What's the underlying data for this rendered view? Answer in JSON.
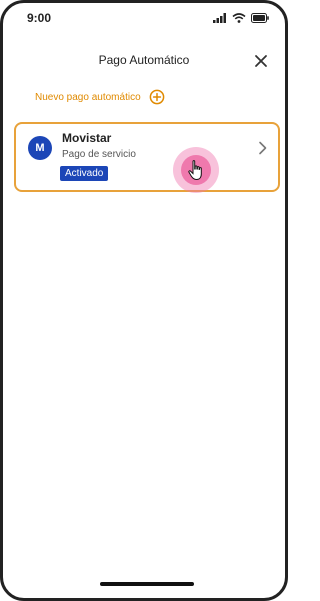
{
  "status_bar": {
    "time": "9:00",
    "icons": [
      "signal-icon",
      "wifi-icon",
      "battery-icon"
    ]
  },
  "header": {
    "title": "Pago Automático",
    "close_icon": "close-icon"
  },
  "new_auto_payment": {
    "label": "Nuevo pago automático",
    "icon": "plus-circle-icon"
  },
  "payments": [
    {
      "avatar_letter": "M",
      "title": "Movistar",
      "subtitle": "Pago de servicio",
      "status_badge": "Activado",
      "icon": "chevron-right-icon"
    }
  ],
  "colors": {
    "accent_orange": "#e08a00",
    "card_border": "#e8a23a",
    "brand_blue": "#1c46b7",
    "tap_indicator": "#ec609e"
  }
}
